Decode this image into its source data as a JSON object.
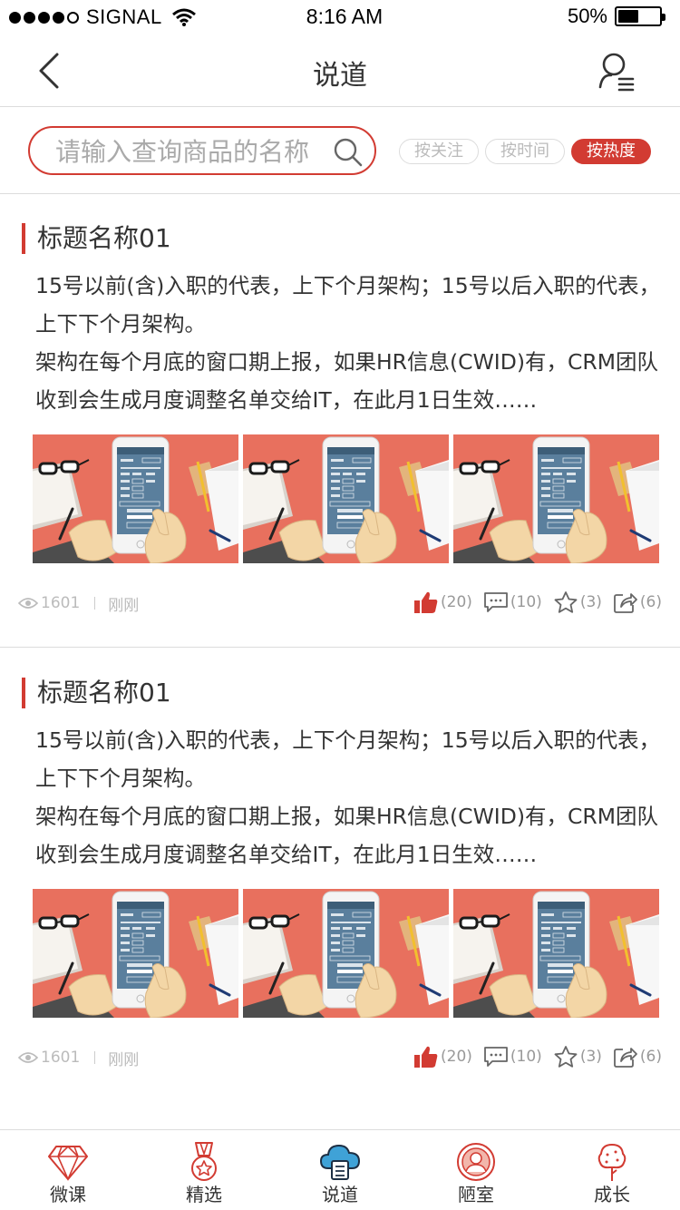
{
  "status_bar": {
    "carrier": "SIGNAL",
    "time": "8:16 AM",
    "battery": "50%",
    "battery_level": 0.5
  },
  "nav": {
    "title": "说道",
    "back_icon": "chevron-left-icon",
    "user_menu_icon": "user-list-icon"
  },
  "search": {
    "placeholder": "请输入查询商品的名称",
    "icon": "search-icon"
  },
  "sort_tabs": [
    {
      "label": "按关注",
      "active": false
    },
    {
      "label": "按时间",
      "active": false
    },
    {
      "label": "按热度",
      "active": true
    }
  ],
  "posts": [
    {
      "title": "标题名称01",
      "paragraph_1": "15号以前(含)入职的代表，上下个月架构；15号以后入职的代表，上下下个月架构。",
      "paragraph_2": "架构在每个月底的窗口期上报，如果HR信息(CWID)有，CRM团队收到会生成月度调整名单交给IT，在此月1日生效……",
      "views": "1601",
      "time": "刚刚",
      "likes": "(20)",
      "comments": "(10)",
      "favorites": "(3)",
      "shares": "(6)"
    },
    {
      "title": "标题名称01",
      "paragraph_1": "15号以前(含)入职的代表，上下个月架构；15号以后入职的代表，上下下个月架构。",
      "paragraph_2": "架构在每个月底的窗口期上报，如果HR信息(CWID)有，CRM团队收到会生成月度调整名单交给IT，在此月1日生效……",
      "views": "1601",
      "time": "刚刚",
      "likes": "(20)",
      "comments": "(10)",
      "favorites": "(3)",
      "shares": "(6)"
    }
  ],
  "tab_bar": [
    {
      "label": "微课",
      "icon": "diamond-icon"
    },
    {
      "label": "精选",
      "icon": "medal-icon"
    },
    {
      "label": "说道",
      "icon": "cloud-chat-icon",
      "active": true
    },
    {
      "label": "陋室",
      "icon": "person-circle-icon"
    },
    {
      "label": "成长",
      "icon": "tree-icon"
    }
  ],
  "colors": {
    "accent": "#d23b32",
    "text": "#333333",
    "muted": "#bbbbbb",
    "divider": "#dcdcdc"
  }
}
